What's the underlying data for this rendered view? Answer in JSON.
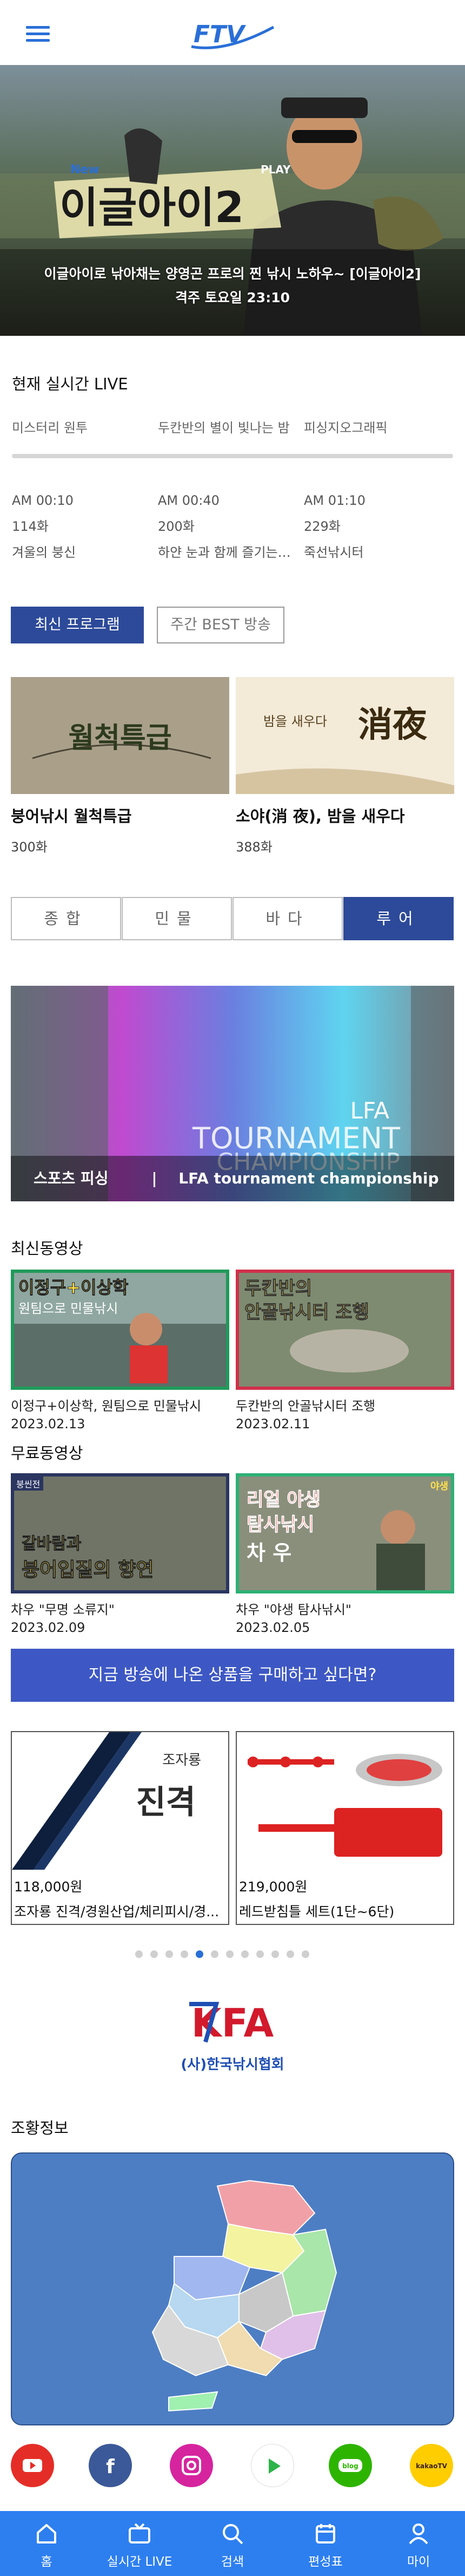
{
  "header": {
    "logo_text": "FTV"
  },
  "hero": {
    "show_title": "이글아이2",
    "title_tag_new": "New",
    "title_tag_play": "PLAY",
    "caption_line1": "이글아이로 낚아채는 양영곤 프로의 찐 낚시 노하우~ [이글아이2]",
    "caption_line2": "격주 토요일 23:10",
    "active_slide": 2,
    "slides": 4
  },
  "live": {
    "title": "현재 실시간 LIVE",
    "channels": [
      "미스터리 원투",
      "두칸반의 별이 빛나는 밤",
      "피싱지오그래픽"
    ],
    "schedule": [
      {
        "time": "AM 00:10",
        "episode": "114화",
        "name": "겨울의 붕신"
      },
      {
        "time": "AM 00:40",
        "episode": "200화",
        "name": "하얀 눈과 함께 즐기는 ..."
      },
      {
        "time": "AM 01:10",
        "episode": "229화",
        "name": "죽선낚시터"
      }
    ]
  },
  "program_tabs": {
    "latest": "최신 프로그램",
    "best": "주간 BEST 방송"
  },
  "programs": [
    {
      "name": "붕어낚시 월척특급",
      "episode": "300화",
      "thumb_text": "월척특급"
    },
    {
      "name": "소야(消 夜), 밤을 새우다",
      "episode": "388화",
      "thumb_text": "消夜",
      "thumb_sub": "밤을 새우다"
    }
  ],
  "categories": [
    "종합",
    "민물",
    "바다",
    "루어"
  ],
  "active_category": 3,
  "banner": {
    "overlay_line1": "LFA",
    "overlay_line2": "TOURNAMENT",
    "overlay_line3": "CHAMPIONSHIP",
    "category": "스포츠 피싱",
    "separator": "|",
    "title": "LFA tournament championship"
  },
  "recent_videos": {
    "title": "최신동영상",
    "items": [
      {
        "title": "이정구+이상학, 원팀으로 민물낚시",
        "date": "2023.02.13",
        "thumb_line1": "이정구+이상학",
        "thumb_line2": "원팀으로 민물낚시"
      },
      {
        "title": "두칸반의 안골낚시터 조행",
        "date": "2023.02.11",
        "thumb_line1": "두칸반의",
        "thumb_line2": "안골낚시터 조행"
      }
    ]
  },
  "free_videos": {
    "title": "무료동영상",
    "items": [
      {
        "title": "차우 \"무명 소류지\"",
        "date": "2023.02.09",
        "thumb_tag": "붕씬전",
        "thumb_line1": "갈바람과",
        "thumb_line2": "붕어입질의 향연"
      },
      {
        "title": "차우 \"야생 탐사낚시\"",
        "date": "2023.02.05",
        "thumb_tag": "야생",
        "thumb_line1": "리얼 야생",
        "thumb_line2": "탐사낚시",
        "thumb_line3": "차 우"
      }
    ]
  },
  "shop": {
    "button": "지금 방송에 나온 상품을 구매하고 싶다면?",
    "items": [
      {
        "price": "118,000원",
        "name": "조자룡 진격/경원산업/체리피시/경...",
        "thumb_text": "진격",
        "thumb_brand": "조자룡"
      },
      {
        "price": "219,000원",
        "name": "레드받침틀 세트(1단~6단)"
      }
    ],
    "dots": 12,
    "active_dot": 4
  },
  "kfa": {
    "logo_text": "KFA",
    "org_name": "(사)한국낚시협회"
  },
  "fishing_info": {
    "title": "조황정보"
  },
  "social": [
    {
      "name": "youtube",
      "color": "#e52d27"
    },
    {
      "name": "facebook",
      "color": "#3b5998"
    },
    {
      "name": "instagram",
      "color": "#d6249f"
    },
    {
      "name": "play",
      "color": "#ffffff"
    },
    {
      "name": "blog",
      "color": "#2db400",
      "label": "blog"
    },
    {
      "name": "kakaotv",
      "color": "#ffcd00",
      "label": "kakaoTV"
    }
  ],
  "bottom_nav": [
    {
      "label": "홈"
    },
    {
      "label": "실시간 LIVE"
    },
    {
      "label": "검색"
    },
    {
      "label": "편성표"
    },
    {
      "label": "마이"
    }
  ],
  "colors": {
    "accent": "#2d4a9a",
    "nav": "#2d7ff0",
    "button": "#3d58c4"
  }
}
